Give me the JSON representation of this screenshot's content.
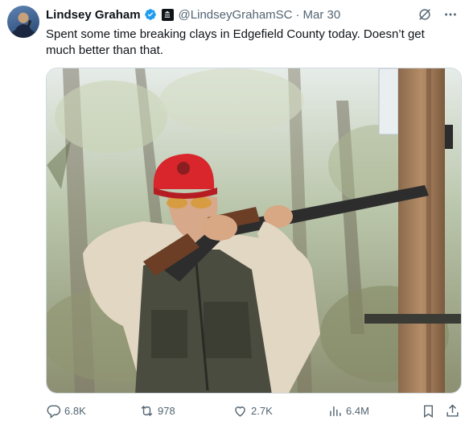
{
  "author": {
    "name": "Lindsey Graham",
    "handle": "@LindseyGrahamSC",
    "separator": "·",
    "date": "Mar 30"
  },
  "tweet": {
    "text": "Spent some time breaking clays in Edgefield County today. Doesn’t get much better than that."
  },
  "actions": {
    "replies": "6.8K",
    "reposts": "978",
    "likes": "2.7K",
    "views": "6.4M"
  },
  "colors": {
    "verified": "#1d9bf0",
    "text_primary": "#0f1419",
    "text_secondary": "#536471",
    "cap": "#d8262c"
  },
  "icons": [
    "verified-badge-icon",
    "government-affiliation-icon",
    "grok-icon",
    "more-icon",
    "reply-icon",
    "repost-icon",
    "like-icon",
    "views-icon",
    "bookmark-icon",
    "share-icon"
  ]
}
